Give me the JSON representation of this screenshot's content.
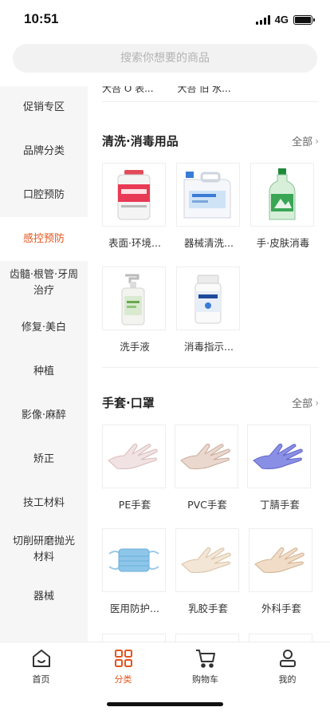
{
  "status": {
    "time": "10:51",
    "network": "4G"
  },
  "search": {
    "placeholder": "搜索你想要的商品"
  },
  "sidebar": {
    "items": [
      {
        "label": "促销专区"
      },
      {
        "label": "品牌分类"
      },
      {
        "label": "口腔预防"
      },
      {
        "label": "感控预防"
      },
      {
        "label": "齿髓·根管·牙周治疗"
      },
      {
        "label": "修复·美白"
      },
      {
        "label": "种植"
      },
      {
        "label": "影像·麻醉"
      },
      {
        "label": "矫正"
      },
      {
        "label": "技工材料"
      },
      {
        "label": "切削研磨抛光材料"
      },
      {
        "label": "器械"
      }
    ],
    "active_index": 3
  },
  "content": {
    "partial_top": [
      "大吾 O 表...",
      "大吾 旧 水..."
    ],
    "sections": [
      {
        "title": "清洗·消毒用品",
        "all_label": "全部",
        "products": [
          {
            "name": "表面·环境...",
            "icon": "wipes-canister-icon"
          },
          {
            "name": "器械清洗...",
            "icon": "cleaner-jug-icon"
          },
          {
            "name": "手·皮肤消毒",
            "icon": "green-bottle-icon"
          },
          {
            "name": "洗手液",
            "icon": "pump-bottle-icon"
          },
          {
            "name": "消毒指示...",
            "icon": "indicator-jar-icon"
          }
        ]
      },
      {
        "title": "手套·口罩",
        "all_label": "全部",
        "products": [
          {
            "name": "PE手套",
            "icon": "pe-glove-icon"
          },
          {
            "name": "PVC手套",
            "icon": "pvc-glove-icon"
          },
          {
            "name": "丁腈手套",
            "icon": "nitrile-glove-icon"
          },
          {
            "name": "医用防护...",
            "icon": "face-mask-icon"
          },
          {
            "name": "乳胶手套",
            "icon": "latex-glove-icon"
          },
          {
            "name": "外科手套",
            "icon": "surgical-glove-icon"
          }
        ]
      }
    ]
  },
  "tabbar": {
    "items": [
      {
        "label": "首页",
        "icon": "home-icon"
      },
      {
        "label": "分类",
        "icon": "category-icon"
      },
      {
        "label": "购物车",
        "icon": "cart-icon"
      },
      {
        "label": "我的",
        "icon": "user-icon"
      }
    ],
    "active_index": 1
  },
  "colors": {
    "accent": "#e2551d",
    "sidebar_bg": "#f6f6f6"
  }
}
